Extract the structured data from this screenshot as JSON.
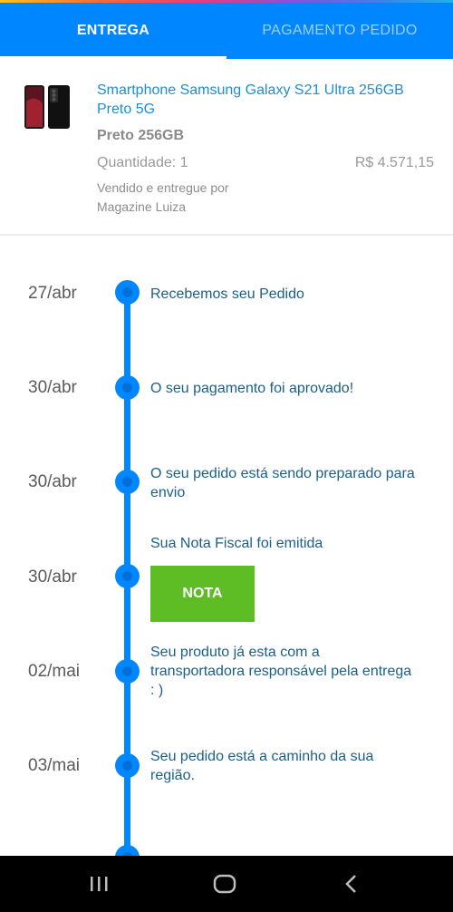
{
  "tabs": {
    "delivery": "ENTREGA",
    "payment": "PAGAMENTO PEDIDO"
  },
  "product": {
    "title": "Smartphone Samsung Galaxy S21 Ultra 256GB Preto 5G",
    "variant": "Preto 256GB",
    "quantity": "Quantidade: 1",
    "price": "R$ 4.571,15",
    "seller_label": "Vendido e entregue por",
    "seller_name": "Magazine Luiza"
  },
  "timeline": [
    {
      "date": "27/abr",
      "text": "Recebemos seu Pedido"
    },
    {
      "date": "30/abr",
      "text": "O seu pagamento foi aprovado!"
    },
    {
      "date": "30/abr",
      "text": "O seu pedido está sendo preparado para envio"
    },
    {
      "date": "30/abr",
      "text": "Sua Nota Fiscal foi emitida",
      "button": "NOTA"
    },
    {
      "date": "02/mai",
      "text": "Seu produto já esta com a transportadora responsável pela entrega : )"
    },
    {
      "date": "03/mai",
      "text": "Seu pedido está a caminho da sua região."
    }
  ],
  "colors": {
    "accent": "#0086ff",
    "nota_button": "#5ebd24"
  },
  "navbar": {
    "icons": [
      "recent-apps-icon",
      "home-icon",
      "back-icon"
    ]
  }
}
